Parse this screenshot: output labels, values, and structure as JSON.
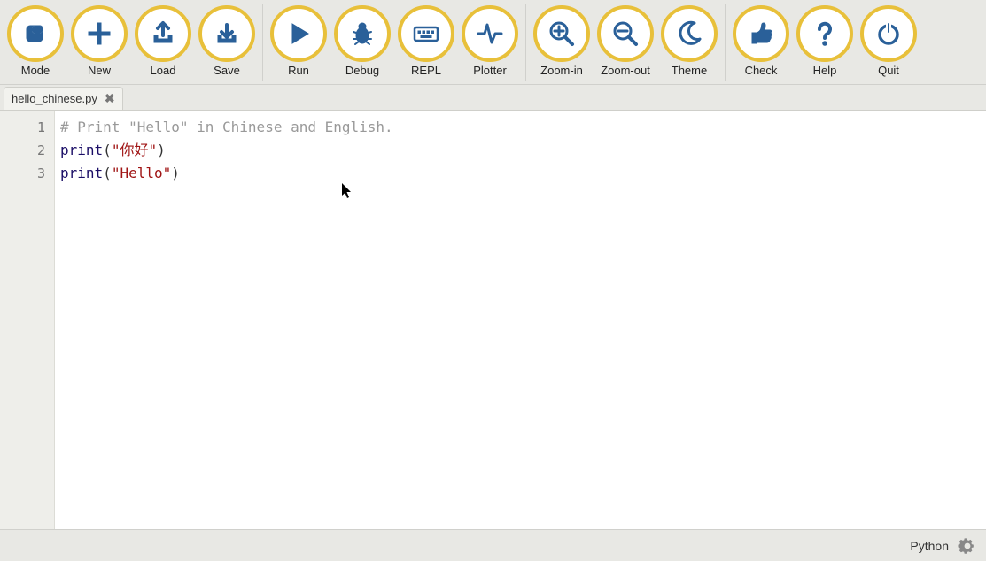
{
  "toolbar": {
    "groups": [
      {
        "items": [
          {
            "id": "mode",
            "label": "Mode",
            "icon": "mode"
          },
          {
            "id": "new",
            "label": "New",
            "icon": "plus"
          },
          {
            "id": "load",
            "label": "Load",
            "icon": "load"
          },
          {
            "id": "save",
            "label": "Save",
            "icon": "save"
          }
        ]
      },
      {
        "items": [
          {
            "id": "run",
            "label": "Run",
            "icon": "play"
          },
          {
            "id": "debug",
            "label": "Debug",
            "icon": "bug"
          },
          {
            "id": "repl",
            "label": "REPL",
            "icon": "keyboard"
          },
          {
            "id": "plotter",
            "label": "Plotter",
            "icon": "pulse"
          }
        ]
      },
      {
        "items": [
          {
            "id": "zoomin",
            "label": "Zoom-in",
            "icon": "zoomin"
          },
          {
            "id": "zoomout",
            "label": "Zoom-out",
            "icon": "zoomout"
          },
          {
            "id": "theme",
            "label": "Theme",
            "icon": "moon"
          }
        ]
      },
      {
        "items": [
          {
            "id": "check",
            "label": "Check",
            "icon": "thumb"
          },
          {
            "id": "help",
            "label": "Help",
            "icon": "question"
          },
          {
            "id": "quit",
            "label": "Quit",
            "icon": "power"
          }
        ]
      }
    ]
  },
  "tabs": [
    {
      "filename": "hello_chinese.py"
    }
  ],
  "code": {
    "lines": [
      {
        "n": "1",
        "tokens": [
          {
            "cls": "c-comment",
            "t": "# Print \"Hello\" in Chinese and English."
          }
        ]
      },
      {
        "n": "2",
        "tokens": [
          {
            "cls": "c-kw",
            "t": "print"
          },
          {
            "cls": "c-paren",
            "t": "("
          },
          {
            "cls": "c-str",
            "t": "\"你好\""
          },
          {
            "cls": "c-paren",
            "t": ")"
          }
        ]
      },
      {
        "n": "3",
        "tokens": [
          {
            "cls": "c-kw",
            "t": "print"
          },
          {
            "cls": "c-paren",
            "t": "("
          },
          {
            "cls": "c-str",
            "t": "\"Hello\""
          },
          {
            "cls": "c-paren",
            "t": ")"
          }
        ]
      }
    ]
  },
  "status": {
    "language": "Python"
  },
  "colors": {
    "toolbar_ring": "#e8c03a",
    "icon_fg": "#2a6099",
    "comment": "#999999",
    "keyword": "#1a0d66",
    "string": "#a01515"
  }
}
